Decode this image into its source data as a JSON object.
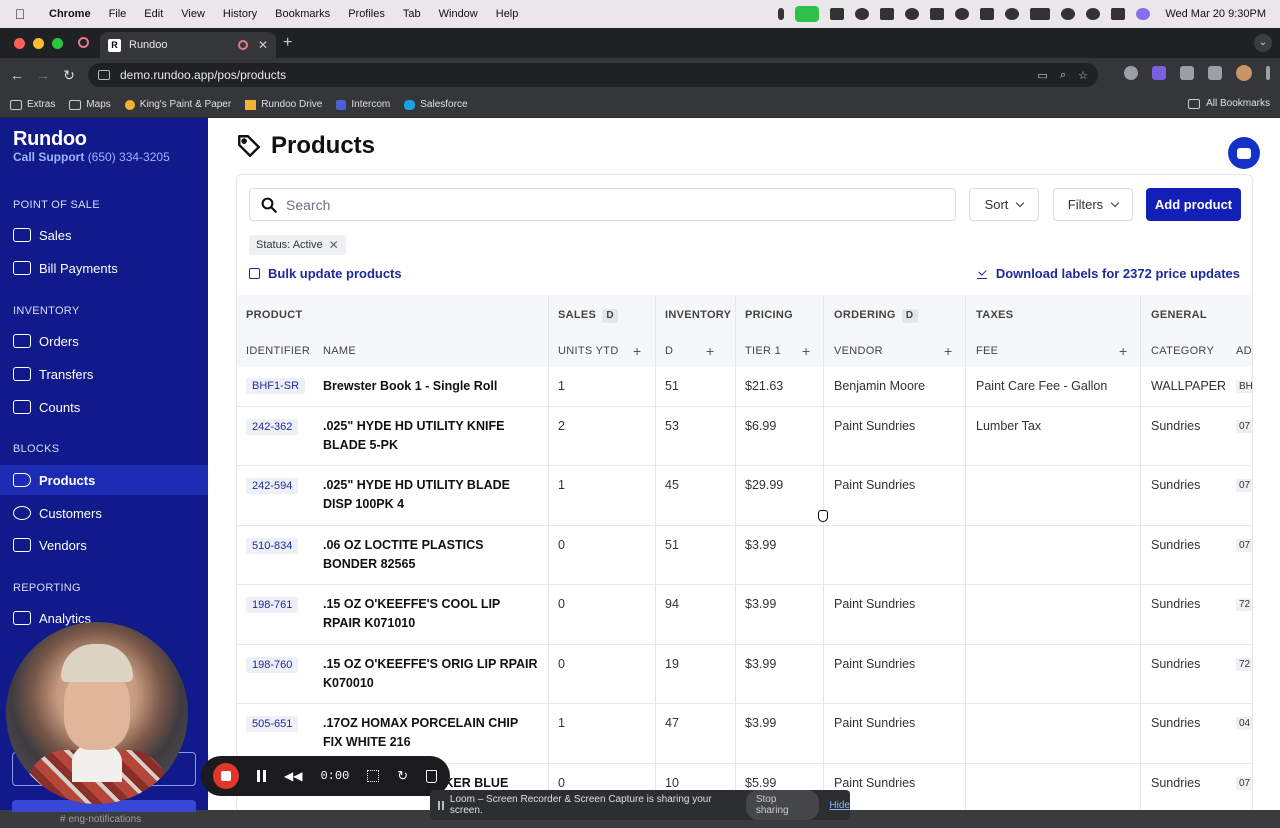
{
  "menubar": {
    "app": "Chrome",
    "items": [
      "File",
      "Edit",
      "View",
      "History",
      "Bookmarks",
      "Profiles",
      "Tab",
      "Window",
      "Help"
    ],
    "clock": "Wed Mar 20  9:30PM"
  },
  "browser": {
    "tab_title": "Rundoo",
    "url": "demo.rundoo.app/pos/products",
    "bookmarks": [
      "Extras",
      "Maps",
      "King's Paint & Paper",
      "Rundoo Drive",
      "Intercom",
      "Salesforce"
    ],
    "all_bookmarks": "All Bookmarks"
  },
  "sidebar": {
    "brand": "Rundoo",
    "support_label": "Call Support",
    "support_phone": "(650) 334-3205",
    "sections": {
      "pos": "POINT OF SALE",
      "inventory": "INVENTORY",
      "blocks": "BLOCKS",
      "reporting": "REPORTING"
    },
    "items": {
      "sales": "Sales",
      "bill_payments": "Bill Payments",
      "orders": "Orders",
      "transfers": "Transfers",
      "counts": "Counts",
      "products": "Products",
      "customers": "Customers",
      "vendors": "Vendors",
      "analytics": "Analytics"
    },
    "active": "products"
  },
  "page": {
    "title": "Products",
    "search_placeholder": "Search",
    "sort_label": "Sort",
    "filters_label": "Filters",
    "add_label": "Add product",
    "filter_chip": "Status: Active",
    "bulk_update": "Bulk update products",
    "download_labels": "Download labels for 2372 price updates"
  },
  "table": {
    "groups": {
      "product": "PRODUCT",
      "sales": "SALES",
      "inventory": "INVENTORY",
      "pricing": "PRICING",
      "ordering": "ORDERING",
      "taxes": "TAXES",
      "general": "GENERAL"
    },
    "badge": "D",
    "columns": {
      "identifier": "IDENTIFIER",
      "name": "NAME",
      "units_ytd": "UNITS YTD",
      "inventory_d": "D",
      "tier1": "TIER 1",
      "vendor": "VENDOR",
      "fee": "FEE",
      "category": "CATEGORY",
      "add": "ADD"
    },
    "rows": [
      {
        "id": "BHF1-SR",
        "name": "Brewster Book 1 - Single Roll",
        "units": "1",
        "inventory": "51",
        "price": "$21.63",
        "vendor": "Benjamin Moore",
        "fee": "Paint Care Fee - Gallon",
        "category": "WALLPAPER",
        "add": "BH"
      },
      {
        "id": "242-362",
        "name": ".025\" HYDE HD UTILITY KNIFE BLADE 5-PK",
        "units": "2",
        "inventory": "53",
        "price": "$6.99",
        "vendor": "Paint Sundries",
        "fee": "Lumber Tax",
        "category": "Sundries",
        "add": "07"
      },
      {
        "id": "242-594",
        "name": ".025\" HYDE HD UTILITY BLADE DISP 100PK 4",
        "units": "1",
        "inventory": "45",
        "price": "$29.99",
        "vendor": "Paint Sundries",
        "fee": "",
        "category": "Sundries",
        "add": "07"
      },
      {
        "id": "510-834",
        "name": ".06 OZ LOCTITE PLASTICS BONDER 82565",
        "units": "0",
        "inventory": "51",
        "price": "$3.99",
        "vendor": "",
        "fee": "",
        "category": "Sundries",
        "add": "07"
      },
      {
        "id": "198-761",
        "name": ".15 OZ O'KEEFFE'S COOL LIP RPAIR K071010",
        "units": "0",
        "inventory": "94",
        "price": "$3.99",
        "vendor": "Paint Sundries",
        "fee": "",
        "category": "Sundries",
        "add": "72"
      },
      {
        "id": "198-760",
        "name": ".15 OZ O'KEEFFE'S ORIG LIP RPAIR K070010",
        "units": "0",
        "inventory": "19",
        "price": "$3.99",
        "vendor": "Paint Sundries",
        "fee": "",
        "category": "Sundries",
        "add": "72"
      },
      {
        "id": "505-651",
        "name": ".17OZ HOMAX PORCELAIN CHIP FIX WHITE 216",
        "units": "1",
        "inventory": "47",
        "price": "$3.99",
        "vendor": "Paint Sundries",
        "fee": "",
        "category": "Sundries",
        "add": "04"
      },
      {
        "id": "",
        "name": "LOCKER BLUE",
        "units": "0",
        "inventory": "10",
        "price": "$5.99",
        "vendor": "Paint Sundries",
        "fee": "",
        "category": "Sundries",
        "add": "07"
      }
    ]
  },
  "loom": {
    "timer": "0:00",
    "share_text": "Loom – Screen Recorder & Screen Capture is sharing your screen.",
    "stop_sharing": "Stop sharing",
    "hide": "Hide"
  },
  "background_tab": "# eng-notifications"
}
